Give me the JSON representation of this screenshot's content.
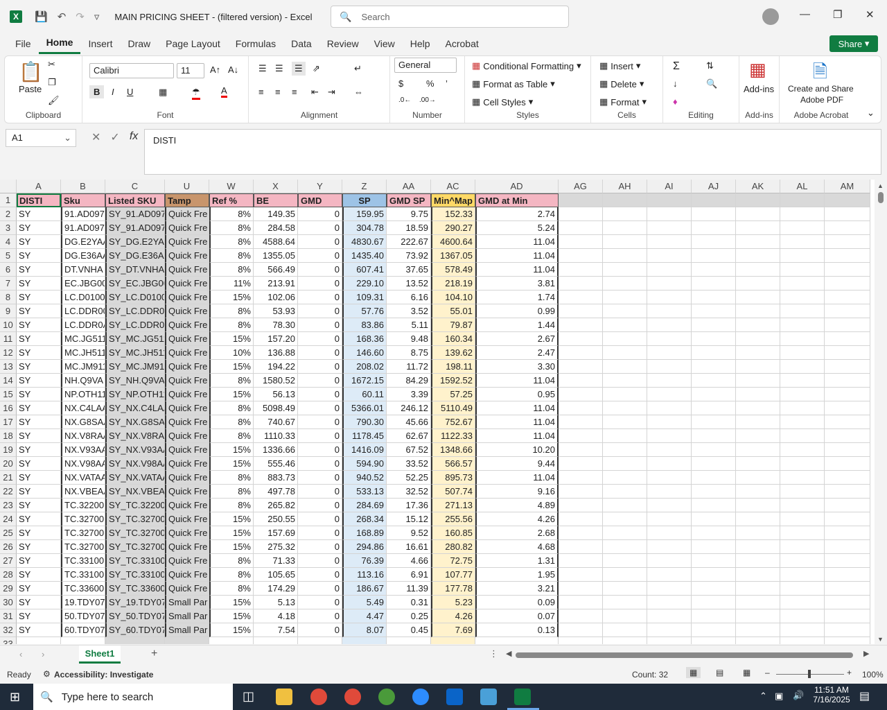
{
  "titlebar": {
    "doc_title": "MAIN PRICING SHEET - (filtered version)  -  Excel",
    "search_placeholder": "Search"
  },
  "tabs": [
    "File",
    "Home",
    "Insert",
    "Draw",
    "Page Layout",
    "Formulas",
    "Data",
    "Review",
    "View",
    "Help",
    "Acrobat"
  ],
  "share_label": "Share",
  "ribbon": {
    "clipboard": {
      "label": "Clipboard",
      "paste": "Paste"
    },
    "font": {
      "label": "Font",
      "name": "Calibri",
      "size": "11"
    },
    "alignment": {
      "label": "Alignment"
    },
    "number": {
      "label": "Number",
      "format": "General"
    },
    "styles": {
      "label": "Styles",
      "conditional": "Conditional Formatting",
      "format_table": "Format as Table",
      "cell_styles": "Cell Styles"
    },
    "cells": {
      "label": "Cells",
      "insert": "Insert",
      "delete": "Delete",
      "format": "Format"
    },
    "editing": {
      "label": "Editing"
    },
    "addins": {
      "label": "Add-ins",
      "btn": "Add-ins"
    },
    "adobe": {
      "label": "Adobe Acrobat",
      "btn1": "Create and Share",
      "btn2": "Adobe PDF"
    }
  },
  "formula_bar": {
    "name_box": "A1",
    "content": "DISTI"
  },
  "columns": [
    {
      "letter": "A",
      "w": 64
    },
    {
      "letter": "B",
      "w": 64
    },
    {
      "letter": "C",
      "w": 86
    },
    {
      "letter": "U",
      "w": 64
    },
    {
      "letter": "W",
      "w": 64
    },
    {
      "letter": "X",
      "w": 64
    },
    {
      "letter": "Y",
      "w": 64
    },
    {
      "letter": "Z",
      "w": 64
    },
    {
      "letter": "AA",
      "w": 64
    },
    {
      "letter": "AC",
      "w": 64
    },
    {
      "letter": "AD",
      "w": 120
    },
    {
      "letter": "AG",
      "w": 64
    },
    {
      "letter": "AH",
      "w": 64
    },
    {
      "letter": "AI",
      "w": 64
    },
    {
      "letter": "AJ",
      "w": 64
    },
    {
      "letter": "AK",
      "w": 64
    },
    {
      "letter": "AL",
      "w": 64
    },
    {
      "letter": "AM",
      "w": 66
    }
  ],
  "headers": [
    "DISTI",
    "Sku",
    "Listed SKU",
    "Tamp",
    "Ref %",
    "BE",
    "GMD",
    "SP",
    "GMD SP",
    "Min^Map",
    "GMD at Min"
  ],
  "header_colors": [
    "#f4b6c2",
    "#f4b6c2",
    "#f4b6c2",
    "#c8956c",
    "#f4b6c2",
    "#f4b6c2",
    "#f4b6c2",
    "#9dc3e6",
    "#f4b6c2",
    "#ffd966",
    "#f4b6c2"
  ],
  "rows": [
    [
      "SY",
      "91.AD097.",
      "SY_91.AD097.",
      "Quick Fre",
      "8%",
      "149.35",
      "0",
      "159.95",
      "9.75",
      "152.33",
      "2.74"
    ],
    [
      "SY",
      "91.AD097.",
      "SY_91.AD097.",
      "Quick Fre",
      "8%",
      "284.58",
      "0",
      "304.78",
      "18.59",
      "290.27",
      "5.24"
    ],
    [
      "SY",
      "DG.E2YAA",
      "SY_DG.E2YAA",
      "Quick Fre",
      "8%",
      "4588.64",
      "0",
      "4830.67",
      "222.67",
      "4600.64",
      "11.04"
    ],
    [
      "SY",
      "DG.E36AA",
      "SY_DG.E36AA",
      "Quick Fre",
      "8%",
      "1355.05",
      "0",
      "1435.40",
      "73.92",
      "1367.05",
      "11.04"
    ],
    [
      "SY",
      "DT.VNHA",
      "SY_DT.VNHA",
      "Quick Fre",
      "8%",
      "566.49",
      "0",
      "607.41",
      "37.65",
      "578.49",
      "11.04"
    ],
    [
      "SY",
      "EC.JBG00.",
      "SY_EC.JBG00.",
      "Quick Fre",
      "11%",
      "213.91",
      "0",
      "229.10",
      "13.52",
      "218.19",
      "3.81"
    ],
    [
      "SY",
      "LC.D0100.",
      "SY_LC.D0100.",
      "Quick Fre",
      "15%",
      "102.06",
      "0",
      "109.31",
      "6.16",
      "104.10",
      "1.74"
    ],
    [
      "SY",
      "LC.DDR00.",
      "SY_LC.DDR00.",
      "Quick Fre",
      "8%",
      "53.93",
      "0",
      "57.76",
      "3.52",
      "55.01",
      "0.99"
    ],
    [
      "SY",
      "LC.DDR0A",
      "SY_LC.DDR0A",
      "Quick Fre",
      "8%",
      "78.30",
      "0",
      "83.86",
      "5.11",
      "79.87",
      "1.44"
    ],
    [
      "SY",
      "MC.JG511",
      "SY_MC.JG511",
      "Quick Fre",
      "15%",
      "157.20",
      "0",
      "168.36",
      "9.48",
      "160.34",
      "2.67"
    ],
    [
      "SY",
      "MC.JH511",
      "SY_MC.JH511",
      "Quick Fre",
      "10%",
      "136.88",
      "0",
      "146.60",
      "8.75",
      "139.62",
      "2.47"
    ],
    [
      "SY",
      "MC.JM911",
      "SY_MC.JM911",
      "Quick Fre",
      "15%",
      "194.22",
      "0",
      "208.02",
      "11.72",
      "198.11",
      "3.30"
    ],
    [
      "SY",
      "NH.Q9VA",
      "SY_NH.Q9VA",
      "Quick Fre",
      "8%",
      "1580.52",
      "0",
      "1672.15",
      "84.29",
      "1592.52",
      "11.04"
    ],
    [
      "SY",
      "NP.OTH11",
      "SY_NP.OTH11",
      "Quick Fre",
      "15%",
      "56.13",
      "0",
      "60.11",
      "3.39",
      "57.25",
      "0.95"
    ],
    [
      "SY",
      "NX.C4LAA",
      "SY_NX.C4LAA",
      "Quick Fre",
      "8%",
      "5098.49",
      "0",
      "5366.01",
      "246.12",
      "5110.49",
      "11.04"
    ],
    [
      "SY",
      "NX.G8SAA",
      "SY_NX.G8SAA",
      "Quick Fre",
      "8%",
      "740.67",
      "0",
      "790.30",
      "45.66",
      "752.67",
      "11.04"
    ],
    [
      "SY",
      "NX.V8RAA",
      "SY_NX.V8RAA",
      "Quick Fre",
      "8%",
      "1110.33",
      "0",
      "1178.45",
      "62.67",
      "1122.33",
      "11.04"
    ],
    [
      "SY",
      "NX.V93AA",
      "SY_NX.V93AA",
      "Quick Fre",
      "15%",
      "1336.66",
      "0",
      "1416.09",
      "67.52",
      "1348.66",
      "10.20"
    ],
    [
      "SY",
      "NX.V98AA",
      "SY_NX.V98AA",
      "Quick Fre",
      "15%",
      "555.46",
      "0",
      "594.90",
      "33.52",
      "566.57",
      "9.44"
    ],
    [
      "SY",
      "NX.VATAA",
      "SY_NX.VATAA",
      "Quick Fre",
      "8%",
      "883.73",
      "0",
      "940.52",
      "52.25",
      "895.73",
      "11.04"
    ],
    [
      "SY",
      "NX.VBEAA",
      "SY_NX.VBEAA",
      "Quick Fre",
      "8%",
      "497.78",
      "0",
      "533.13",
      "32.52",
      "507.74",
      "9.16"
    ],
    [
      "SY",
      "TC.32200.",
      "SY_TC.32200.",
      "Quick Fre",
      "8%",
      "265.82",
      "0",
      "284.69",
      "17.36",
      "271.13",
      "4.89"
    ],
    [
      "SY",
      "TC.32700.",
      "SY_TC.32700.",
      "Quick Fre",
      "15%",
      "250.55",
      "0",
      "268.34",
      "15.12",
      "255.56",
      "4.26"
    ],
    [
      "SY",
      "TC.32700.",
      "SY_TC.32700.",
      "Quick Fre",
      "15%",
      "157.69",
      "0",
      "168.89",
      "9.52",
      "160.85",
      "2.68"
    ],
    [
      "SY",
      "TC.32700.",
      "SY_TC.32700.",
      "Quick Fre",
      "15%",
      "275.32",
      "0",
      "294.86",
      "16.61",
      "280.82",
      "4.68"
    ],
    [
      "SY",
      "TC.33100.",
      "SY_TC.33100.",
      "Quick Fre",
      "8%",
      "71.33",
      "0",
      "76.39",
      "4.66",
      "72.75",
      "1.31"
    ],
    [
      "SY",
      "TC.33100.",
      "SY_TC.33100.",
      "Quick Fre",
      "8%",
      "105.65",
      "0",
      "113.16",
      "6.91",
      "107.77",
      "1.95"
    ],
    [
      "SY",
      "TC.33600.",
      "SY_TC.33600.",
      "Quick Fre",
      "8%",
      "174.29",
      "0",
      "186.67",
      "11.39",
      "177.78",
      "3.21"
    ],
    [
      "SY",
      "19.TDY07.",
      "SY_19.TDY07.",
      "Small Par",
      "15%",
      "5.13",
      "0",
      "5.49",
      "0.31",
      "5.23",
      "0.09"
    ],
    [
      "SY",
      "50.TDY07.",
      "SY_50.TDY07.",
      "Small Par",
      "15%",
      "4.18",
      "0",
      "4.47",
      "0.25",
      "4.26",
      "0.07"
    ],
    [
      "SY",
      "60.TDY07.",
      "SY_60.TDY07.",
      "Small Par",
      "15%",
      "7.54",
      "0",
      "8.07",
      "0.45",
      "7.69",
      "0.13"
    ]
  ],
  "sheet_tab": "Sheet1",
  "status": {
    "ready": "Ready",
    "accessibility": "Accessibility: Investigate",
    "count": "Count: 32",
    "zoom": "100%"
  },
  "taskbar": {
    "search": "Type here to search",
    "time": "11:51 AM",
    "date": "7/16/2025"
  }
}
